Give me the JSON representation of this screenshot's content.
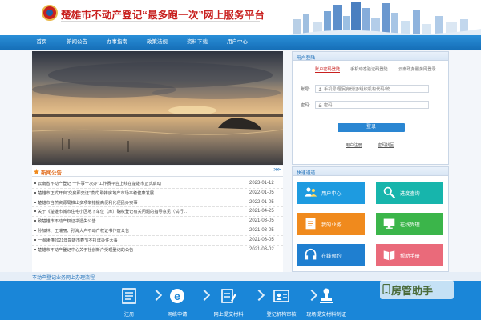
{
  "header": {
    "site_title": "楚雄市不动产登记“最多跑一次”网上服务平台"
  },
  "nav": {
    "items": [
      {
        "label": "首页"
      },
      {
        "label": "新闻公告"
      },
      {
        "label": "办事指南"
      },
      {
        "label": "政策法规"
      },
      {
        "label": "资料下载"
      },
      {
        "label": "用户中心"
      }
    ]
  },
  "news": {
    "title": "新闻公告",
    "more": ">>>",
    "items": [
      {
        "text": "云南省不动产登记“一件事一次办”工作赛平台上线在楚雄市正式启动",
        "date": "2023-01-12"
      },
      {
        "text": "楚雄市正式开启“交房即交证”模式 助推房地产市场平稳健康发展",
        "date": "2022-01-05"
      },
      {
        "text": "楚雄市自然资源局推出多项举措提高便利化便民办实事",
        "date": "2022-01-05"
      },
      {
        "text": "关于《楚雄市城市住宅小区地下车位（库）确权登记有关问题的指导意见（试行...",
        "date": "2021-04-25"
      },
      {
        "text": "致楚雄市不动产权证书遗失公告",
        "date": "2021-03-05"
      },
      {
        "text": "孙加林、王瑞丽、孙海大户不动产权证书作废公告",
        "date": "2021-03-05"
      },
      {
        "text": "一图读懂2021年楚雄市春节不打烊办件大事",
        "date": "2021-03-05"
      },
      {
        "text": "楚雄市不动产登记中心关于社创新户受理登记的公告",
        "date": "2021-03-02"
      }
    ]
  },
  "login": {
    "panel_title": "用户登陆",
    "tabs": [
      {
        "label": "账户密码登陆"
      },
      {
        "label": "手机动态验证码登陆"
      },
      {
        "label": "云南政务服务网登录"
      }
    ],
    "account_label": "账号:",
    "account_placeholder": "手机号/居民身份证/组织机构代码/统",
    "password_label": "密码:",
    "password_placeholder": "密码",
    "submit": "登录",
    "register": "用户注册",
    "forgot": "密码找回"
  },
  "quick": {
    "title": "快速通道",
    "tiles": [
      {
        "label": "用户中心",
        "color": "#1e9be0"
      },
      {
        "label": "进度查询",
        "color": "#17b5ac"
      },
      {
        "label": "我的业务",
        "color": "#f08a1d"
      },
      {
        "label": "在线受理",
        "color": "#3bb54a"
      },
      {
        "label": "在线预约",
        "color": "#1f7fd0"
      },
      {
        "label": "帮助手册",
        "color": "#ea6a7a"
      }
    ]
  },
  "process": {
    "title": "不动产登记业务网上办理流程",
    "steps": [
      {
        "label": "注册"
      },
      {
        "label": "网络申请"
      },
      {
        "label": "网上提交材料"
      },
      {
        "label": "登记机构审核"
      },
      {
        "label": "现场提交材料制证"
      }
    ]
  },
  "watermark": {
    "text": "房管助手"
  },
  "colors": {
    "brand_red": "#c8201f",
    "nav_blue": "#1a7ccc",
    "process_blue": "#1a86d8"
  }
}
